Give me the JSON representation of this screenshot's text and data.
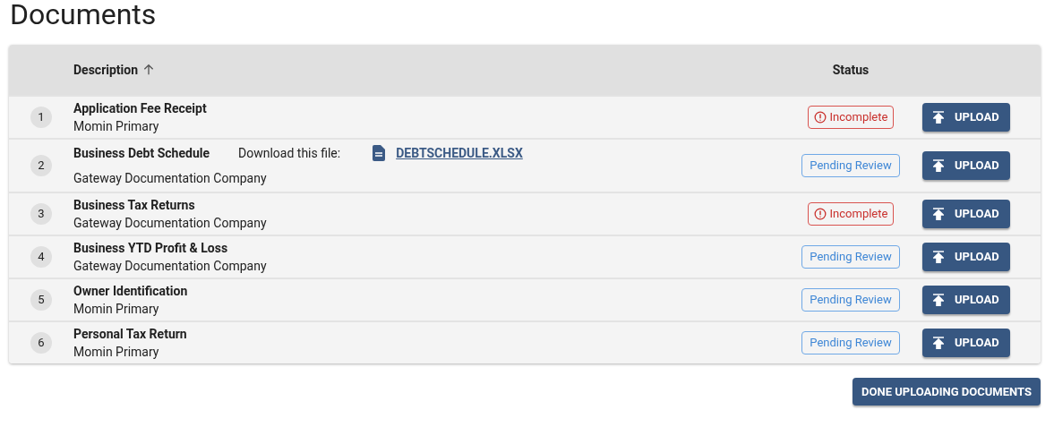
{
  "title": "Documents",
  "table": {
    "columns": [
      {
        "label": "Description",
        "sorted": true
      },
      {
        "label": "Status"
      }
    ],
    "rows": [
      {
        "number": "1",
        "name": "Application Fee Receipt",
        "owner": "Momin Primary",
        "status": {
          "kind": "incomplete",
          "label": "Incomplete"
        },
        "action": "UPLOAD"
      },
      {
        "number": "2",
        "name": "Business Debt Schedule",
        "download": {
          "label": "Download this file:",
          "file": "DEBTSCHEDULE.XLSX"
        },
        "owner": "Gateway Documentation Company",
        "status": {
          "kind": "pending",
          "label": "Pending Review"
        },
        "action": "UPLOAD"
      },
      {
        "number": "3",
        "name": "Business Tax Returns",
        "owner": "Gateway Documentation Company",
        "status": {
          "kind": "incomplete",
          "label": "Incomplete"
        },
        "action": "UPLOAD"
      },
      {
        "number": "4",
        "name": "Business YTD Profit & Loss",
        "owner": "Gateway Documentation Company",
        "status": {
          "kind": "pending",
          "label": "Pending Review"
        },
        "action": "UPLOAD"
      },
      {
        "number": "5",
        "name": "Owner Identification",
        "owner": "Momin Primary",
        "status": {
          "kind": "pending",
          "label": "Pending Review"
        },
        "action": "UPLOAD"
      },
      {
        "number": "6",
        "name": "Personal Tax Return",
        "owner": "Momin Primary",
        "status": {
          "kind": "pending",
          "label": "Pending Review"
        },
        "action": "UPLOAD"
      }
    ]
  },
  "done_button": "DONE UPLOADING DOCUMENTS"
}
